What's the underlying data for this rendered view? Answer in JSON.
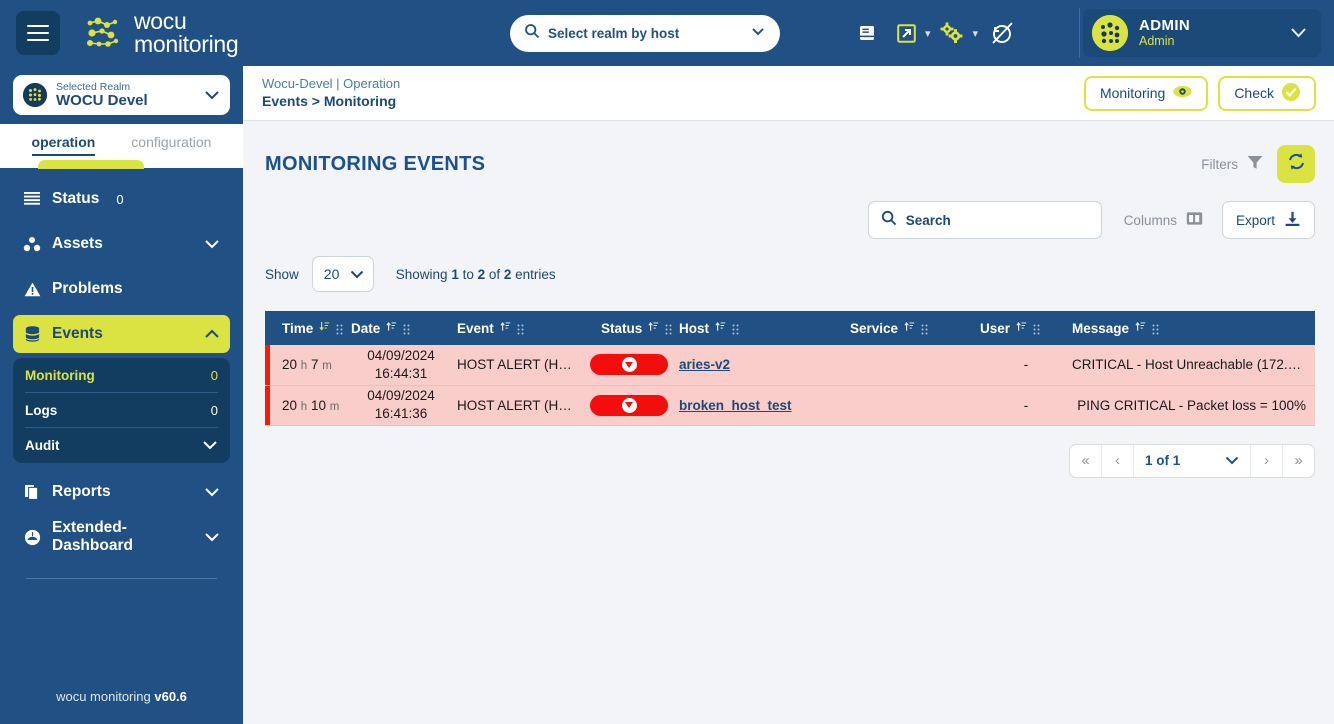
{
  "header": {
    "menu_icon": "hamburger-icon",
    "brand_line1": "wocu",
    "brand_line2": "monitoring",
    "realm_search_placeholder": "Select realm by host",
    "icons": [
      {
        "name": "docs-book-icon"
      },
      {
        "name": "external-link-icon"
      },
      {
        "name": "settings-gears-icon"
      },
      {
        "name": "no-refresh-icon"
      }
    ],
    "user": {
      "name": "ADMIN",
      "role": "Admin"
    }
  },
  "sidebar": {
    "realm": {
      "label": "Selected Realm",
      "value": "WOCU Devel"
    },
    "tabs": [
      {
        "label": "operation",
        "active": true
      },
      {
        "label": "configuration",
        "active": false
      }
    ],
    "items": [
      {
        "label": "Status",
        "count": "0",
        "icon": "list-icon",
        "expandable": false
      },
      {
        "label": "Assets",
        "count": "",
        "icon": "assets-icon",
        "expandable": true
      },
      {
        "label": "Problems",
        "count": "",
        "icon": "warning-triangle-icon",
        "expandable": false
      },
      {
        "label": "Events",
        "count": "",
        "icon": "database-icon",
        "expandable": true,
        "active": true
      }
    ],
    "events_submenu": [
      {
        "label": "Monitoring",
        "value": "0",
        "active": true
      },
      {
        "label": "Logs",
        "value": "0",
        "active": false
      },
      {
        "label": "Audit",
        "value": "",
        "active": false,
        "expandable": true
      }
    ],
    "items_after": [
      {
        "label": "Reports",
        "icon": "document-icon",
        "expandable": true
      },
      {
        "label": "Extended-Dashboard",
        "icon": "gauge-icon",
        "expandable": true
      }
    ],
    "version_prefix": "wocu monitoring",
    "version": "v60.6"
  },
  "breadcrumb": {
    "top": "Wocu-Devel | Operation",
    "bottom": "Events > Monitoring",
    "buttons": [
      {
        "label": "Monitoring",
        "icon": "eye-icon"
      },
      {
        "label": "Check",
        "icon": "check-circle-icon"
      }
    ]
  },
  "page": {
    "title": "MONITORING EVENTS",
    "filters_label": "Filters",
    "refresh_icon": "refresh-icon",
    "search_placeholder": "Search",
    "columns_label": "Columns",
    "export_label": "Export",
    "show_label": "Show",
    "show_value": "20",
    "showing_text_parts": [
      "Showing ",
      "1",
      " to ",
      "2",
      " of ",
      "2",
      " entries"
    ]
  },
  "table": {
    "columns": [
      {
        "label": "Time",
        "sorted": true
      },
      {
        "label": "Date",
        "sorted": false
      },
      {
        "label": "Event",
        "sorted": false
      },
      {
        "label": "Status",
        "sorted": false
      },
      {
        "label": "Host",
        "sorted": false
      },
      {
        "label": "Service",
        "sorted": false
      },
      {
        "label": "User",
        "sorted": false
      },
      {
        "label": "Message",
        "sorted": false
      }
    ],
    "rows": [
      {
        "time_value": "20",
        "time_unit1": "h",
        "time_value2": "7",
        "time_unit2": "m",
        "date": "04/09/2024",
        "time_of_day": "16:44:31",
        "event": "HOST ALERT (H…",
        "status": "down",
        "host": "aries-v2",
        "service": "",
        "user": "-",
        "message": "CRITICAL - Host Unreachable (172.1…"
      },
      {
        "time_value": "20",
        "time_unit1": "h",
        "time_value2": "10",
        "time_unit2": "m",
        "date": "04/09/2024",
        "time_of_day": "16:41:36",
        "event": "HOST ALERT (H…",
        "status": "down",
        "host": "broken_host_test",
        "service": "",
        "user": "-",
        "message": "PING CRITICAL - Packet loss = 100%"
      }
    ]
  },
  "pagination": {
    "first": "«",
    "prev": "‹",
    "current": "1 of 1",
    "next": "›",
    "last": "»"
  },
  "colors": {
    "brand_blue": "#215184",
    "dark_blue": "#123c60",
    "accent_yellow": "#dbe343",
    "critical_red": "#f40d0d",
    "row_red_bg": "#f9cdc9",
    "link_blue": "#1b4a78"
  }
}
